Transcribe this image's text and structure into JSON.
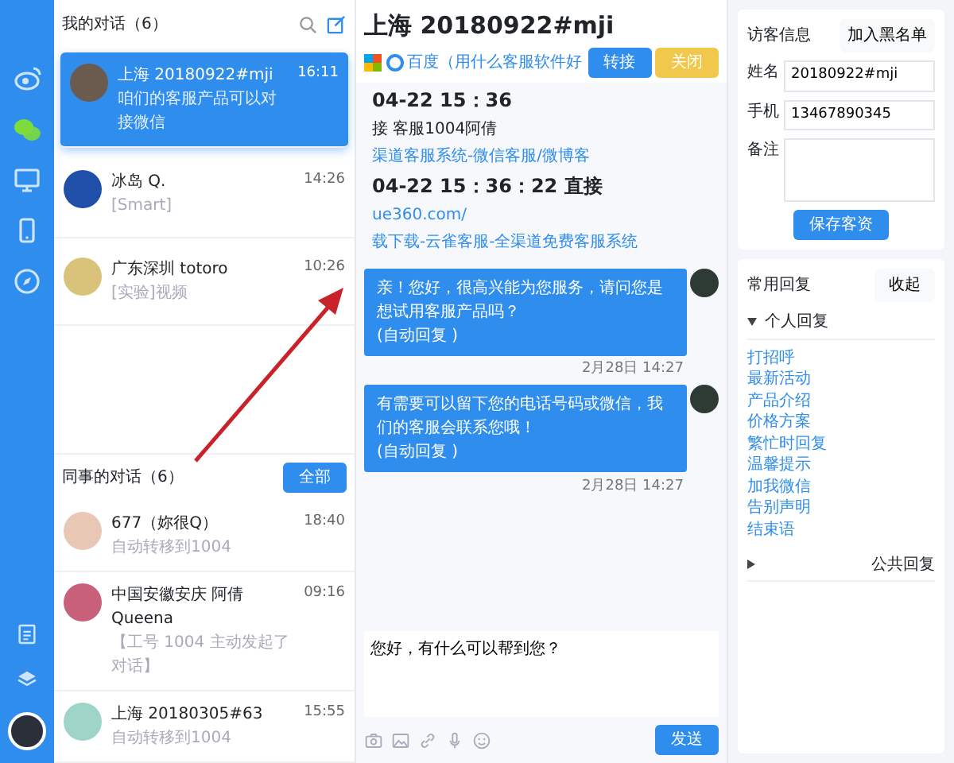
{
  "rail": {
    "icons": [
      {
        "kind": "weibo",
        "selected": false
      },
      {
        "kind": "chat",
        "selected": true
      },
      {
        "kind": "monitor",
        "selected": false
      },
      {
        "kind": "phone",
        "selected": false
      },
      {
        "kind": "compass",
        "selected": false
      }
    ],
    "bottom_icons": [
      {
        "kind": "note"
      },
      {
        "kind": "layers"
      }
    ]
  },
  "my_conversations": {
    "title": "我的对话（6）",
    "items": [
      {
        "name": "上海 20180922#mji",
        "time": "16:11",
        "preview": "咱们的客服产品可以对接微信",
        "selected": true
      },
      {
        "name": "冰岛 Q.",
        "time": "14:26",
        "preview": "[Smart]",
        "selected": false
      },
      {
        "name": "广东深圳 totoro",
        "time": "10:26",
        "preview": "[实验]视频",
        "selected": false
      }
    ]
  },
  "colleague_conversations": {
    "title": "同事的对话（6）",
    "button": "全部",
    "items": [
      {
        "name": "677（妳很Q）",
        "time": "18:40",
        "preview": "自动转移到1004"
      },
      {
        "name": "中国安徽安庆 阿倩Queena",
        "time": "09:16",
        "preview": "【工号 1004 主动发起了对话】"
      },
      {
        "name": "上海 20180305#63",
        "time": "15:55",
        "preview": "自动转移到1004"
      }
    ]
  },
  "chat": {
    "title": "上海 20180922#mji",
    "source": "百度（用什么客服软件好",
    "buttons": [
      {
        "label": "转接",
        "kind": "primary"
      },
      {
        "label": "关闭",
        "kind": "warning"
      }
    ],
    "system_lines": [
      {
        "kind": "time",
        "text": "04-22 15：36"
      },
      {
        "kind": "text",
        "text": "接 客服1004阿倩"
      },
      {
        "kind": "link",
        "text": "渠道客服系统-微信客服/微博客"
      },
      {
        "kind": "time",
        "text": "04-22 15：36：22 直接"
      },
      {
        "kind": "link",
        "text": "ue360.com/"
      },
      {
        "kind": "link",
        "text": "载下载-云雀客服-全渠道免费客服系统"
      }
    ],
    "messages": [
      {
        "text": "亲！您好，很高兴能为您服务，请问您是想试用客服产品吗？",
        "note": "(自动回复 )",
        "time": "2月28日 14:27"
      },
      {
        "text": "有需要可以留下您的电话号码或微信，我们的客服会联系您哦！",
        "note": "(自动回复 )",
        "time": "2月28日 14:27"
      }
    ],
    "input_value": "您好，有什么可以帮到您？",
    "tools": [
      {
        "kind": "camera"
      },
      {
        "kind": "image"
      },
      {
        "kind": "link"
      },
      {
        "kind": "mic"
      },
      {
        "kind": "emoji"
      }
    ],
    "send_button": "发送"
  },
  "visitor": {
    "title": "访客信息",
    "blacklist_button": "加入黑名单",
    "fields": [
      {
        "label": "姓名",
        "value": "20180922#mji",
        "kind": "input"
      },
      {
        "label": "手机",
        "value": "13467890345",
        "kind": "input"
      },
      {
        "label": "备注",
        "kind": "textarea"
      }
    ],
    "save_button": "保存客资"
  },
  "quick_replies": {
    "title": "常用回复",
    "button": "收起",
    "groups": [
      {
        "label": "个人回复",
        "expanded": true,
        "items": [
          "打招呼",
          "最新活动",
          "产品介绍",
          "价格方案",
          "繁忙时回复",
          "温馨提示",
          "加我微信",
          "告别声明",
          "结束语"
        ]
      },
      {
        "label": "公共回复",
        "expanded": false
      }
    ]
  }
}
